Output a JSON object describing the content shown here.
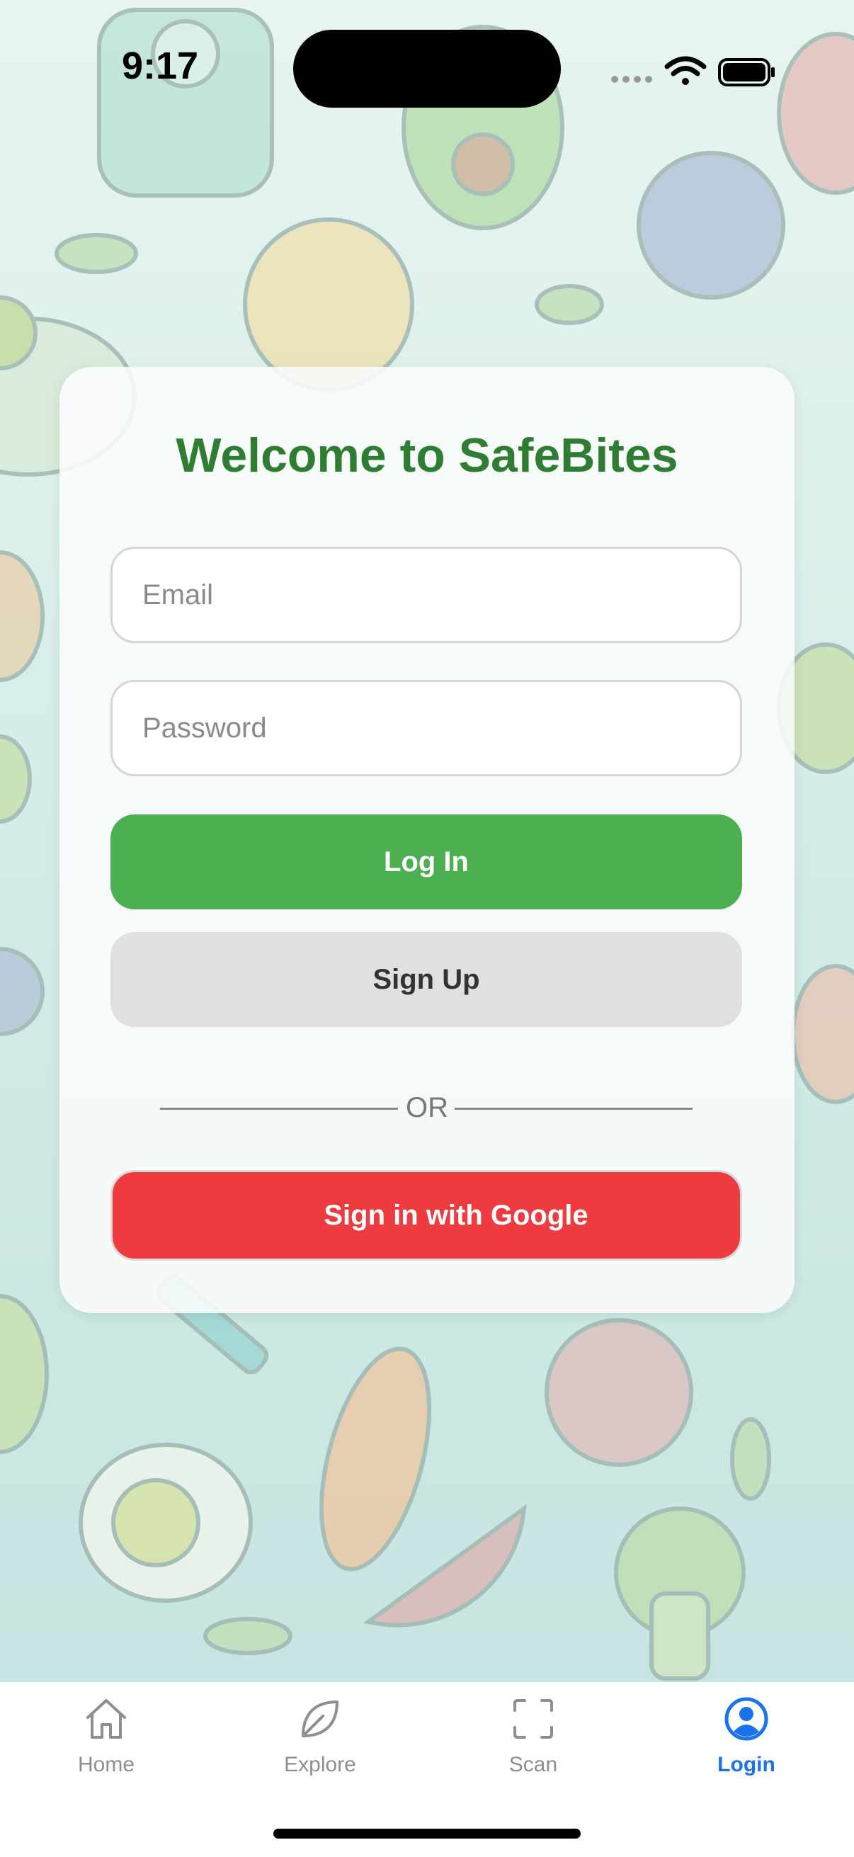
{
  "status_bar": {
    "time": "9:17"
  },
  "login_card": {
    "title": "Welcome to SafeBites",
    "email_placeholder": "Email",
    "email_value": "",
    "password_placeholder": "Password",
    "password_value": "",
    "login_label": "Log In",
    "signup_label": "Sign Up",
    "divider_text": "OR",
    "google_label": "Sign in with Google"
  },
  "tab_bar": {
    "items": [
      {
        "label": "Home",
        "icon": "house-icon"
      },
      {
        "label": "Explore",
        "icon": "leaf-icon"
      },
      {
        "label": "Scan",
        "icon": "scan-frame-icon"
      },
      {
        "label": "Login",
        "icon": "person-circle-icon",
        "active": true
      }
    ]
  },
  "colors": {
    "title_green": "#2e7d32",
    "login_button": "#4caf50",
    "signup_button": "#e0e0e0",
    "google_button": "#ee3b3f",
    "active_tab": "#1a73e8",
    "inactive_tab": "#8e8e8e"
  }
}
